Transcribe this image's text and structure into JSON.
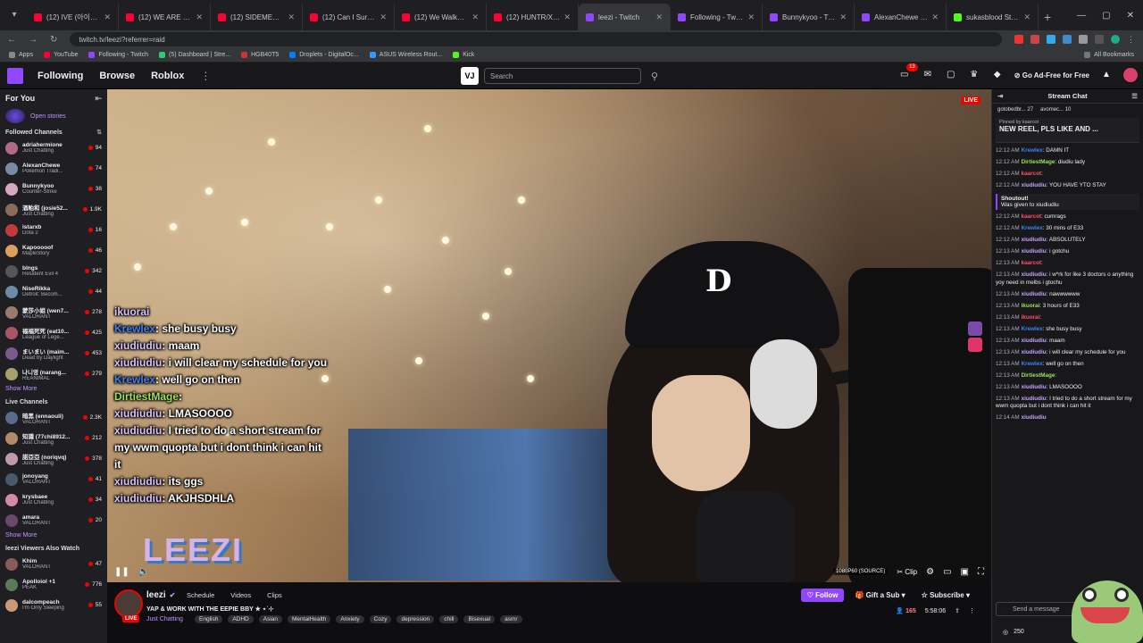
{
  "browser": {
    "tabs": [
      {
        "title": "(12) IVE (아이브)의 힐링제",
        "color": "#ff0033"
      },
      {
        "title": "(12) WE ARE SO READY 🔥",
        "color": "#ff0033"
      },
      {
        "title": "(12) SIDEMEN FAMILY FO",
        "color": "#ff0033"
      },
      {
        "title": "(12) Can I Survive My Co",
        "color": "#ff0033"
      },
      {
        "title": "(12) We Walked A 24KM",
        "color": "#ff0033"
      },
      {
        "title": "(12) HUNTR/X perform \"G",
        "color": "#ff0033"
      },
      {
        "title": "leezi - Twitch",
        "color": "#9147ff",
        "active": true
      },
      {
        "title": "Following - Twitch",
        "color": "#9147ff"
      },
      {
        "title": "Bunnykyoo - Twitch",
        "color": "#9147ff"
      },
      {
        "title": "AlexanChewe - Twitch",
        "color": "#9147ff"
      },
      {
        "title": "sukasblood Stream - Wat",
        "color": "#53fc18"
      }
    ],
    "url": "twitch.tv/leezi?referrer=raid",
    "bookmarks": [
      {
        "label": "Apps",
        "color": "#888"
      },
      {
        "label": "YouTube",
        "color": "#ff0033"
      },
      {
        "label": "Following - Twitch",
        "color": "#9147ff"
      },
      {
        "label": "(5) Dashboard | Stre...",
        "color": "#2ecc71"
      },
      {
        "label": "HGB40T5",
        "color": "#cc3333"
      },
      {
        "label": "Droplets - DigitalOc...",
        "color": "#0080ff"
      },
      {
        "label": "ASUS Wireless Rout...",
        "color": "#3399ff"
      },
      {
        "label": "Kick",
        "color": "#53fc18"
      }
    ],
    "all_bookmarks": "All Bookmarks"
  },
  "twitch_nav": {
    "links": [
      "Following",
      "Browse",
      "Roblox"
    ],
    "vj_label": "VJ",
    "search_placeholder": "Search",
    "notif_count": "13",
    "ad_free": "Go Ad-Free for Free"
  },
  "sidebar": {
    "for_you": "For You",
    "open_stories": "Open stories",
    "followed_title": "Followed Channels",
    "followed": [
      {
        "name": "adriahermione",
        "game": "Just Chatting",
        "viewers": "94",
        "color": "#b06a8a"
      },
      {
        "name": "AlexanChewe",
        "game": "Pokémon Tradi...",
        "viewers": "74",
        "color": "#7a8aa6"
      },
      {
        "name": "Bunnykyoo",
        "game": "Counter-Strike",
        "viewers": "38",
        "color": "#d6a5c0"
      },
      {
        "name": "酒粕和 (josie52...",
        "game": "Just Chatting",
        "viewers": "1.9K",
        "color": "#8a6a5a"
      },
      {
        "name": "istarxb",
        "game": "Dota 2",
        "viewers": "16",
        "color": "#c23a3a"
      },
      {
        "name": "Kapooooof",
        "game": "MapleStory",
        "viewers": "46",
        "color": "#d9a060"
      },
      {
        "name": "blngs",
        "game": "Resident Evil 4",
        "viewers": "342",
        "color": "#555"
      },
      {
        "name": "NiseRikka",
        "game": "Detroit: Becom...",
        "viewers": "44",
        "color": "#6a8aa8"
      },
      {
        "name": "蒙莎小姐 (wen7...",
        "game": "VALORANT",
        "viewers": "278",
        "color": "#9a7a6a"
      },
      {
        "name": "福福死死 (eat10...",
        "game": "League of Lege...",
        "viewers": "425",
        "color": "#aa5566"
      },
      {
        "name": "まいまい (maim...",
        "game": "Dead by Daylight",
        "viewers": "453",
        "color": "#7a5a8a"
      },
      {
        "name": "나니영 (narang...",
        "game": "REANIMAL",
        "viewers": "279",
        "color": "#a6a06a"
      }
    ],
    "show_more_1": "Show More",
    "live_title": "Live Channels",
    "live": [
      {
        "name": "暗黑 (ennaouli)",
        "game": "VALORANT",
        "viewers": "2.3K",
        "color": "#5a6a8a"
      },
      {
        "name": "知識 (77chi8912...",
        "game": "Just Chatting",
        "viewers": "212",
        "color": "#b08a6a"
      },
      {
        "name": "諾亞亞 (noriqvq)",
        "game": "Just Chatting",
        "viewers": "378",
        "color": "#c09aa8"
      },
      {
        "name": "jonoyang",
        "game": "VALORANT",
        "viewers": "41",
        "color": "#4a5a6a"
      },
      {
        "name": "krysbaee",
        "game": "Just Chatting",
        "viewers": "34",
        "color": "#d48aa0"
      },
      {
        "name": "amara",
        "game": "VALORANT",
        "viewers": "20",
        "color": "#6a4a6a"
      }
    ],
    "show_more_2": "Show More",
    "also_title": "leezi Viewers Also Watch",
    "also": [
      {
        "name": "Khim",
        "game": "VALORANT",
        "viewers": "47",
        "color": "#8a5a5a"
      },
      {
        "name": "Apolloiol +1",
        "game": "PEAK",
        "viewers": "776",
        "color": "#5a7a5a"
      },
      {
        "name": "dalcompeach",
        "game": "I'm Only Sleeping",
        "viewers": "55",
        "color": "#c89a7a"
      }
    ]
  },
  "video": {
    "live_label": "LIVE",
    "overlay": [
      {
        "user": "ikuorai",
        "text": "",
        "cls": ""
      },
      {
        "user": "Krewlex",
        "text": ": she busy busy",
        "cls": "blue"
      },
      {
        "user": "xiudiudiu",
        "text": ": maam",
        "cls": ""
      },
      {
        "user": "xiudiudiu",
        "text": ": i will clear my schedule for you",
        "cls": ""
      },
      {
        "user": "Krewlex",
        "text": ": well go on then",
        "cls": "blue"
      },
      {
        "user": "DirtiestMage",
        "text": ":",
        "cls": "green"
      },
      {
        "user": "xiudiudiu",
        "text": ": LMASOOOO",
        "cls": ""
      },
      {
        "user": "xiudiudiu",
        "text": ": I tried to do a short stream for my wwm quopta but i dont think i can hit it",
        "cls": ""
      },
      {
        "user": "xiudiudiu",
        "text": ": its ggs",
        "cls": ""
      },
      {
        "user": "xiudiudiu",
        "text": ": AKJHSDHLA",
        "cls": ""
      }
    ],
    "logo_text": "LEEZI",
    "quality": "1080P60 (SOURCE)",
    "clip": "Clip"
  },
  "channel": {
    "name": "leezi",
    "tabs": [
      "Schedule",
      "Videos",
      "Clips"
    ],
    "title": "YAP & WORK WITH THE EEPIE BBY ★ ⋆˙⊹",
    "category": "Just Chatting",
    "tags": [
      "English",
      "ADHD",
      "Asian",
      "MentalHealth",
      "Anxiety",
      "Cozy",
      "depression",
      "chill",
      "Bisexual",
      "asmr"
    ],
    "follow": "Follow",
    "gift": "Gift a Sub",
    "subscribe": "Subscribe",
    "viewers": "165",
    "uptime": "5:58:06",
    "live_badge": "LIVE"
  },
  "chat": {
    "title": "Stream Chat",
    "gifts": [
      "gotobedbr... 27",
      "avomec... 10"
    ],
    "pinned_by": "Pinned by kaarcot",
    "pinned_msg": "NEW REEL, PLS LIKE AND ...",
    "messages": [
      {
        "t": "12:12 AM",
        "u": "Krewlex",
        "c": "#3b82f6",
        "m": ": DAMN IT"
      },
      {
        "t": "12:12 AM",
        "u": "DirtiestMage",
        "c": "#9be15d",
        "m": ": diudiu lady"
      },
      {
        "t": "12:12 AM",
        "u": "kaarcot",
        "c": "#ff4f6d",
        "m": ":"
      },
      {
        "t": "12:12 AM",
        "u": "xiudiudiu",
        "c": "#c4a5ff",
        "m": ": YOU HAVE YTO STAY"
      },
      {
        "t": "12:12 AM",
        "u": "kaarcot",
        "c": "#ff4f6d",
        "m": ": cumrags"
      },
      {
        "t": "12:12 AM",
        "u": "Krewlex",
        "c": "#3b82f6",
        "m": ": 30 mins of E33"
      },
      {
        "t": "12:12 AM",
        "u": "xiudiudiu",
        "c": "#c4a5ff",
        "m": ": ABSOLUTELY"
      },
      {
        "t": "12:13 AM",
        "u": "xiudiudiu",
        "c": "#c4a5ff",
        "m": ": i gotchu"
      },
      {
        "t": "12:13 AM",
        "u": "kaarcot",
        "c": "#ff4f6d",
        "m": ":"
      },
      {
        "t": "12:13 AM",
        "u": "xiudiudiu",
        "c": "#c4a5ff",
        "m": ": i w*rk for like 3 doctors o anything yoy need in melbs i gtochu"
      },
      {
        "t": "12:13 AM",
        "u": "xiudiudiu",
        "c": "#c4a5ff",
        "m": ": nawwwwww"
      },
      {
        "t": "12:13 AM",
        "u": "ikuorai",
        "c": "#9be15d",
        "m": ": 3 hours of E33"
      },
      {
        "t": "12:13 AM",
        "u": "ikuorai",
        "c": "#ff4f6d",
        "m": ":"
      },
      {
        "t": "12:13 AM",
        "u": "Krewlex",
        "c": "#3b82f6",
        "m": ": she busy busy"
      },
      {
        "t": "12:13 AM",
        "u": "xiudiudiu",
        "c": "#c4a5ff",
        "m": ": maam"
      },
      {
        "t": "12:13 AM",
        "u": "xiudiudiu",
        "c": "#c4a5ff",
        "m": ": i will clear my schedule for you"
      },
      {
        "t": "12:13 AM",
        "u": "Krewlex",
        "c": "#3b82f6",
        "m": ": well go on then"
      },
      {
        "t": "12:13 AM",
        "u": "DirtiestMage",
        "c": "#9be15d",
        "m": ":"
      },
      {
        "t": "12:13 AM",
        "u": "xiudiudiu",
        "c": "#c4a5ff",
        "m": ": LMASOOOO"
      },
      {
        "t": "12:13 AM",
        "u": "xiudiudiu",
        "c": "#c4a5ff",
        "m": ": I tried to do a short stream for my wwm quopta but i dont think i can hit it"
      },
      {
        "t": "12:14 AM",
        "u": "xiudiudiu",
        "c": "#c4a5ff",
        "m": ""
      }
    ],
    "shoutout_title": "Shoutout!",
    "shoutout_text": "Was given to xiudiudiu",
    "input_placeholder": "Send a message",
    "points": "250"
  }
}
